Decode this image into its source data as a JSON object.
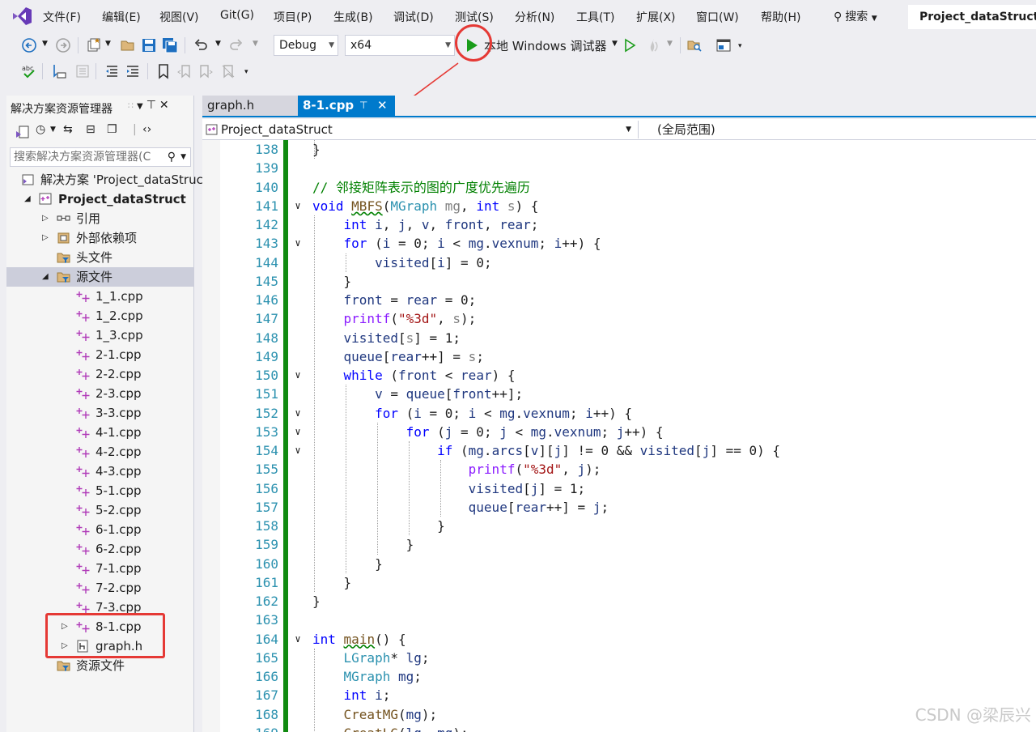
{
  "menu": {
    "items": [
      "文件(F)",
      "编辑(E)",
      "视图(V)",
      "Git(G)",
      "项目(P)",
      "生成(B)",
      "调试(D)",
      "测试(S)",
      "分析(N)",
      "工具(T)",
      "扩展(X)",
      "窗口(W)",
      "帮助(H)"
    ],
    "search_label": "搜索",
    "project_name": "Project_dataStruct"
  },
  "toolbar": {
    "config": "Debug",
    "platform": "x64",
    "run_label": "本地 Windows 调试器"
  },
  "solution_explorer": {
    "title": "解决方案资源管理器",
    "search_placeholder": "搜索解决方案资源管理器(C",
    "tree": [
      {
        "label": "解决方案 'Project_dataStruct'",
        "level": 0,
        "icon": "solution-icon",
        "expand": "none"
      },
      {
        "label": "Project_dataStruct",
        "level": 1,
        "icon": "project-icon",
        "expand": "open",
        "bold": true
      },
      {
        "label": "引用",
        "level": 2,
        "icon": "references-icon",
        "expand": "closed"
      },
      {
        "label": "外部依赖项",
        "level": 2,
        "icon": "external-deps-icon",
        "expand": "closed"
      },
      {
        "label": "头文件",
        "level": 2,
        "icon": "filter-folder-icon",
        "expand": "none"
      },
      {
        "label": "源文件",
        "level": 2,
        "icon": "filter-folder-icon",
        "expand": "open",
        "selected": true
      },
      {
        "label": "1_1.cpp",
        "level": 3,
        "icon": "cpp-file-icon",
        "expand": "none"
      },
      {
        "label": "1_2.cpp",
        "level": 3,
        "icon": "cpp-file-icon",
        "expand": "none"
      },
      {
        "label": "1_3.cpp",
        "level": 3,
        "icon": "cpp-file-icon",
        "expand": "none"
      },
      {
        "label": "2-1.cpp",
        "level": 3,
        "icon": "cpp-file-icon",
        "expand": "none"
      },
      {
        "label": "2-2.cpp",
        "level": 3,
        "icon": "cpp-file-icon",
        "expand": "none"
      },
      {
        "label": "2-3.cpp",
        "level": 3,
        "icon": "cpp-file-icon",
        "expand": "none"
      },
      {
        "label": "3-3.cpp",
        "level": 3,
        "icon": "cpp-file-icon",
        "expand": "none"
      },
      {
        "label": "4-1.cpp",
        "level": 3,
        "icon": "cpp-file-icon",
        "expand": "none"
      },
      {
        "label": "4-2.cpp",
        "level": 3,
        "icon": "cpp-file-icon",
        "expand": "none"
      },
      {
        "label": "4-3.cpp",
        "level": 3,
        "icon": "cpp-file-icon",
        "expand": "none"
      },
      {
        "label": "5-1.cpp",
        "level": 3,
        "icon": "cpp-file-icon",
        "expand": "none"
      },
      {
        "label": "5-2.cpp",
        "level": 3,
        "icon": "cpp-file-icon",
        "expand": "none"
      },
      {
        "label": "6-1.cpp",
        "level": 3,
        "icon": "cpp-file-icon",
        "expand": "none"
      },
      {
        "label": "6-2.cpp",
        "level": 3,
        "icon": "cpp-file-icon",
        "expand": "none"
      },
      {
        "label": "7-1.cpp",
        "level": 3,
        "icon": "cpp-file-icon",
        "expand": "none"
      },
      {
        "label": "7-2.cpp",
        "level": 3,
        "icon": "cpp-file-icon",
        "expand": "none"
      },
      {
        "label": "7-3.cpp",
        "level": 3,
        "icon": "cpp-file-icon",
        "expand": "none"
      },
      {
        "label": "8-1.cpp",
        "level": 3,
        "icon": "cpp-file-icon",
        "expand": "closed"
      },
      {
        "label": "graph.h",
        "level": 3,
        "icon": "header-file-icon",
        "expand": "closed"
      },
      {
        "label": "资源文件",
        "level": 2,
        "icon": "filter-folder-icon",
        "expand": "none"
      }
    ]
  },
  "editor": {
    "tabs": [
      "graph.h",
      "8-1.cpp"
    ],
    "active_tab": "8-1.cpp",
    "nav_project": "Project_dataStruct",
    "nav_scope": "(全局范围)",
    "line_numbers": [
      "138",
      "139",
      "140",
      "141",
      "142",
      "143",
      "144",
      "145",
      "146",
      "147",
      "148",
      "149",
      "150",
      "151",
      "152",
      "153",
      "154",
      "155",
      "156",
      "157",
      "158",
      "159",
      "160",
      "161",
      "162",
      "163",
      "164",
      "165",
      "166",
      "167",
      "168",
      "169"
    ],
    "folds": [
      "",
      "",
      "",
      "v",
      "",
      "v",
      "",
      "",
      "",
      "",
      "",
      "",
      "v",
      "",
      "v",
      "v",
      "v",
      "",
      "",
      "",
      "",
      "",
      "",
      "",
      "",
      "",
      "v",
      "",
      "",
      "",
      "",
      ""
    ],
    "code_lines": [
      "}",
      "",
      "// 邻接矩阵表示的图的广度优先遍历",
      "void MBFS(MGraph mg, int s) {",
      "    int i, j, v, front, rear;",
      "    for (i = 0; i < mg.vexnum; i++) {",
      "        visited[i] = 0;",
      "    }",
      "    front = rear = 0;",
      "    printf(\"%3d\", s);",
      "    visited[s] = 1;",
      "    queue[rear++] = s;",
      "    while (front < rear) {",
      "        v = queue[front++];",
      "        for (i = 0; i < mg.vexnum; i++) {",
      "            for (j = 0; j < mg.vexnum; j++) {",
      "                if (mg.arcs[v][j] != 0 && visited[j] == 0) {",
      "                    printf(\"%3d\", j);",
      "                    visited[j] = 1;",
      "                    queue[rear++] = j;",
      "                }",
      "            }",
      "        }",
      "    }",
      "}",
      "",
      "int main() {",
      "    LGraph* lg;",
      "    MGraph mg;",
      "    int i;",
      "    CreatMG(mg);",
      "    CreatLG(lg, mg);"
    ]
  },
  "watermark": "CSDN @梁辰兴",
  "colors": {
    "accent": "#007acc",
    "changebar": "#108a10",
    "annotation": "#e53935",
    "run_green": "#1a9c1a"
  }
}
